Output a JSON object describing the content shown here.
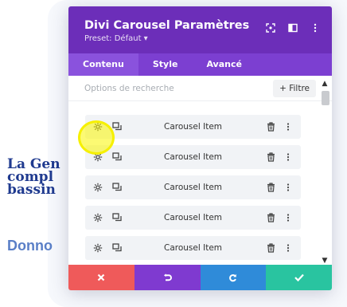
{
  "page": {
    "heading_lines": [
      "La Gen",
      "compl",
      "bassin"
    ],
    "subheading": "Donno"
  },
  "modal": {
    "title": "Divi Carousel Paramètres",
    "preset": "Preset: Défaut ▾",
    "header_icons": [
      "focus-icon",
      "split-view-icon",
      "more-vertical-icon"
    ],
    "tabs": [
      {
        "label": "Contenu",
        "active": true
      },
      {
        "label": "Style",
        "active": false
      },
      {
        "label": "Avancé",
        "active": false
      }
    ],
    "search": {
      "placeholder": "Options de recherche",
      "value": ""
    },
    "filter_label": "+ Filtre",
    "items": [
      {
        "label": "Carousel Item"
      },
      {
        "label": "Carousel Item"
      },
      {
        "label": "Carousel Item"
      },
      {
        "label": "Carousel Item"
      },
      {
        "label": "Carousel Item"
      }
    ],
    "footer_colors": {
      "cancel": "#ef5a5a",
      "undo": "#7f3ad0",
      "redo": "#2f8bd9",
      "save": "#29c4a0"
    },
    "footer_icons": [
      "close-icon",
      "undo-icon",
      "redo-icon",
      "check-icon"
    ]
  },
  "colors": {
    "header": "#6c2eb9",
    "tabs": "#7c3fd1",
    "highlight": "#f6f000"
  }
}
